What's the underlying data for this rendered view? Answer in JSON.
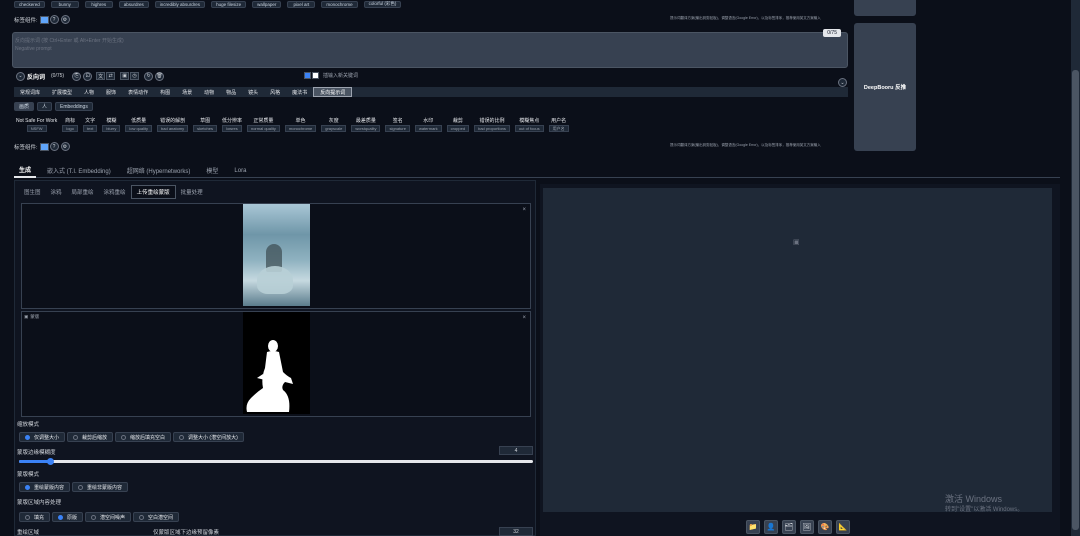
{
  "top_tags": [
    "checkered",
    "bunny",
    "highres",
    "absurdres",
    "incredibly absurdres",
    "huge filesize",
    "wallpaper",
    "pixel art",
    "monochrome",
    "colorful (彩色)"
  ],
  "prompt_helper_label_1": "标签组件:",
  "right_note": "提示词翻译方案(输出到剪贴板)，调整语言(Google Error)，以及标签排序，推荐使用英文方案输入",
  "negative": {
    "placeholder": "反向提示词 (按 Ctrl+Enter 或 Alt+Enter 开始生成)\nNegative prompt",
    "counter": "0/75",
    "title": "反向词",
    "title_count": "(0/75)",
    "insert_label": "插输入新关键词"
  },
  "deepbooru_button": "DeepBooru 反推",
  "category_tabs": [
    "常规词库",
    "扩展模型",
    "人物",
    "服饰",
    "表情动作",
    "构图",
    "场景",
    "动物",
    "物品",
    "镜头",
    "风格",
    "魔法书",
    "反向提示词"
  ],
  "category_active": 12,
  "sub_tabs": [
    "画质",
    "人",
    "Embeddings"
  ],
  "neg_tags": [
    {
      "zh": "Not Safe For Work",
      "en": "NSFW"
    },
    {
      "zh": "商标",
      "en": "logo"
    },
    {
      "zh": "文字",
      "en": "text"
    },
    {
      "zh": "模糊",
      "en": "blurry"
    },
    {
      "zh": "低质量",
      "en": "low quality"
    },
    {
      "zh": "错误的解剖",
      "en": "bad anatomy"
    },
    {
      "zh": "草图",
      "en": "sketches"
    },
    {
      "zh": "低分辨率",
      "en": "lowres"
    },
    {
      "zh": "正常质量",
      "en": "normal quality"
    },
    {
      "zh": "单色",
      "en": "monochrome"
    },
    {
      "zh": "灰度",
      "en": "grayscale"
    },
    {
      "zh": "最差质量",
      "en": "worstquality"
    },
    {
      "zh": "签名",
      "en": "signature"
    },
    {
      "zh": "水印",
      "en": "watermark"
    },
    {
      "zh": "裁剪",
      "en": "cropped"
    },
    {
      "zh": "错误的比例",
      "en": "bad proportions"
    },
    {
      "zh": "模糊焦点",
      "en": "out of focus"
    },
    {
      "zh": "用户名",
      "en": "用户名"
    }
  ],
  "prompt_helper_label_2": "标签组件:",
  "main_tabs": [
    "生成",
    "嵌入式 (T.I. Embedding)",
    "超网络 (Hypernetworks)",
    "模型",
    "Lora"
  ],
  "main_tab_active": 0,
  "img_tabs": [
    "图生图",
    "涂鸦",
    "局部重绘",
    "涂鸦重绘",
    "上传重绘蒙版",
    "批量处理"
  ],
  "img_tab_active": 4,
  "mask_label": "蒙版",
  "resize_mode_label": "缩放模式",
  "resize_modes": [
    "仅调整大小",
    "裁剪后缩放",
    "缩放后填充空白",
    "调整大小 (潜空间放大)"
  ],
  "resize_active": 0,
  "blur_label": "蒙版边缘模糊度",
  "blur_value": "4",
  "blur_fraction": 0.06,
  "mask_mode_label": "蒙版模式",
  "mask_modes": [
    "重绘蒙版内容",
    "重绘非蒙版内容"
  ],
  "mask_mode_active": 0,
  "fill_label": "蒙版区域内容处理",
  "fill_modes": [
    "填充",
    "原版",
    "潜空间噪声",
    "空白潜空间"
  ],
  "fill_active": 1,
  "area_label": "重绘区域",
  "padding_label": "仅蒙版区域下边缘预留像素",
  "padding_value": "32",
  "watermark_title": "激活 Windows",
  "watermark_sub": "转到\"设置\"以激活 Windows。",
  "output_icons": [
    "folder-icon",
    "person-icon",
    "layers-icon",
    "image-icon",
    "palette-icon",
    "ruler-icon"
  ],
  "output_icon_glyphs": [
    "📁",
    "👤",
    "🗂",
    "🖼",
    "🎨",
    "📐"
  ],
  "colors": {
    "bg": "#0b0f19",
    "panel": "#1f2937",
    "accent": "#3b82f6"
  }
}
